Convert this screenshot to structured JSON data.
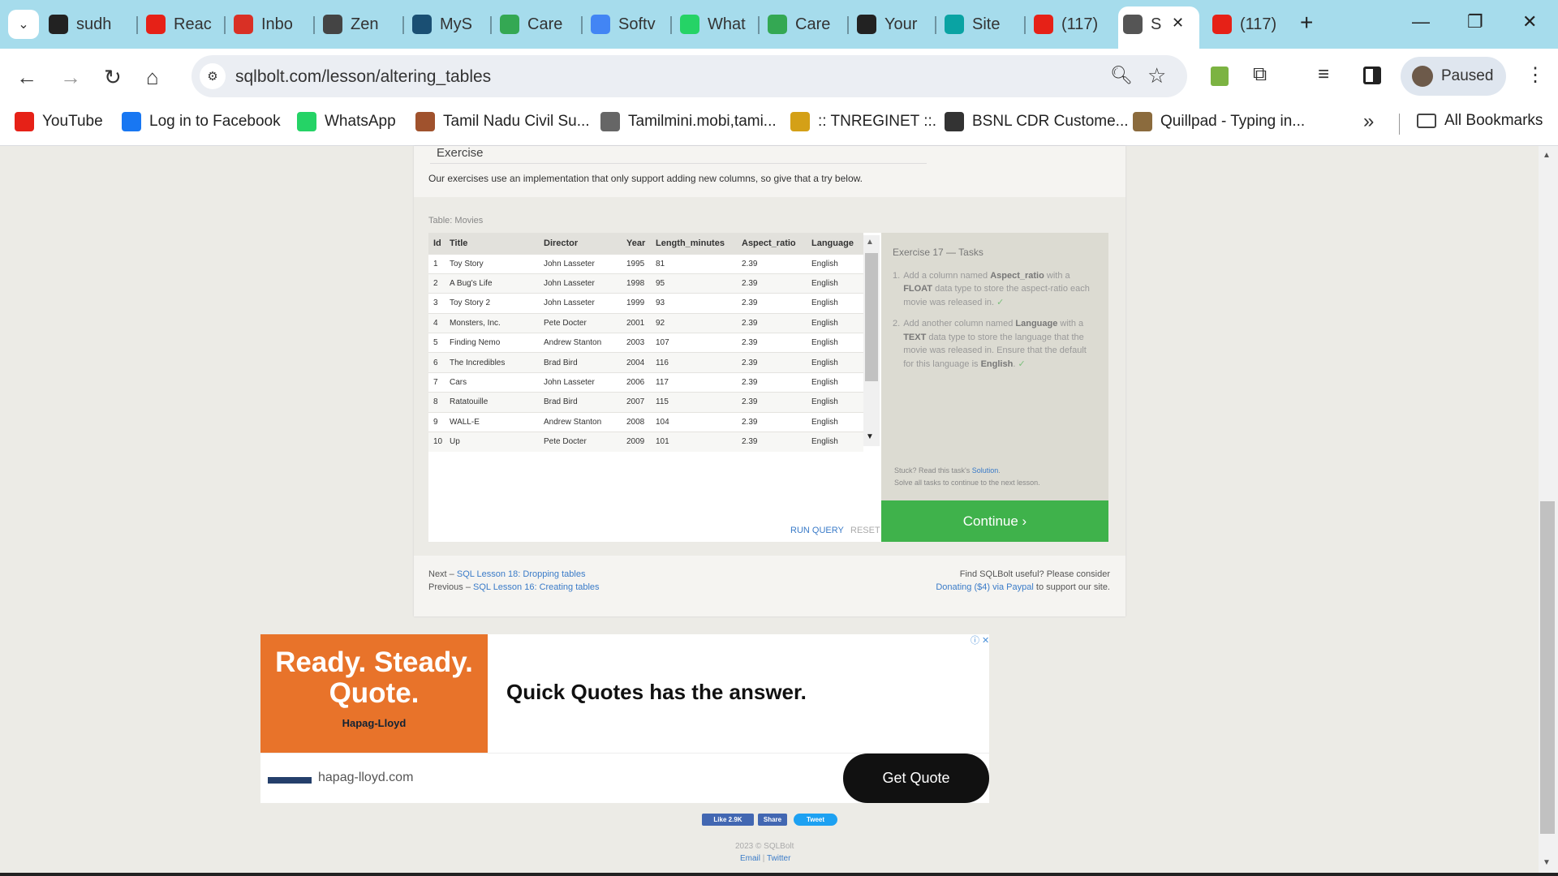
{
  "browser": {
    "tabs": [
      {
        "label": "sudh",
        "icon": "github-icon",
        "color": "#222"
      },
      {
        "label": "Reac",
        "icon": "youtube-icon",
        "color": "#e62117"
      },
      {
        "label": "Inbo",
        "icon": "gmail-icon",
        "color": "#d93025"
      },
      {
        "label": "Zen",
        "icon": "classroom-icon",
        "color": "#444"
      },
      {
        "label": "MyS",
        "icon": "mysql-icon",
        "color": "#1a4f73"
      },
      {
        "label": "Care",
        "icon": "google-circle-icon",
        "color": "#34a853"
      },
      {
        "label": "Softv",
        "icon": "docs-icon",
        "color": "#4285f4"
      },
      {
        "label": "What",
        "icon": "whatsapp-icon",
        "color": "#25d366"
      },
      {
        "label": "Care",
        "icon": "google-circle-icon",
        "color": "#34a853"
      },
      {
        "label": "Your",
        "icon": "github-icon",
        "color": "#222"
      },
      {
        "label": "Site",
        "icon": "diamond-icon",
        "color": "#0aa3a3"
      },
      {
        "label": "(117)",
        "icon": "youtube-icon",
        "color": "#e62117"
      },
      {
        "label": "S",
        "icon": "database-icon",
        "color": "#555",
        "active": true
      },
      {
        "label": "(117)",
        "icon": "youtube-icon",
        "color": "#e62117"
      }
    ],
    "url": "sqlbolt.com/lesson/altering_tables",
    "profile_label": "Paused",
    "bookmarks": [
      {
        "label": "YouTube",
        "color": "#e62117"
      },
      {
        "label": "Log in to Facebook",
        "color": "#1877f2"
      },
      {
        "label": "WhatsApp",
        "color": "#25d366"
      },
      {
        "label": "Tamil Nadu Civil Su...",
        "color": "#a0522d"
      },
      {
        "label": "Tamilmini.mobi,tami...",
        "color": "#666"
      },
      {
        "label": ":: TNREGINET ::.",
        "color": "#d4a017"
      },
      {
        "label": "BSNL CDR Custome...",
        "color": "#333"
      },
      {
        "label": "Quillpad - Typing in...",
        "color": "#8b6b3d"
      }
    ],
    "all_bookmarks": "All Bookmarks"
  },
  "lesson": {
    "exercise_heading": "Exercise",
    "exercise_desc": "Our exercises use an implementation that only support adding new columns, so give that a try below.",
    "table_label": "Table: Movies",
    "columns": [
      "Id",
      "Title",
      "Director",
      "Year",
      "Length_minutes",
      "Aspect_ratio",
      "Language"
    ],
    "rows": [
      [
        "1",
        "Toy Story",
        "John Lasseter",
        "1995",
        "81",
        "2.39",
        "English"
      ],
      [
        "2",
        "A Bug's Life",
        "John Lasseter",
        "1998",
        "95",
        "2.39",
        "English"
      ],
      [
        "3",
        "Toy Story 2",
        "John Lasseter",
        "1999",
        "93",
        "2.39",
        "English"
      ],
      [
        "4",
        "Monsters, Inc.",
        "Pete Docter",
        "2001",
        "92",
        "2.39",
        "English"
      ],
      [
        "5",
        "Finding Nemo",
        "Andrew Stanton",
        "2003",
        "107",
        "2.39",
        "English"
      ],
      [
        "6",
        "The Incredibles",
        "Brad Bird",
        "2004",
        "116",
        "2.39",
        "English"
      ],
      [
        "7",
        "Cars",
        "John Lasseter",
        "2006",
        "117",
        "2.39",
        "English"
      ],
      [
        "8",
        "Ratatouille",
        "Brad Bird",
        "2007",
        "115",
        "2.39",
        "English"
      ],
      [
        "9",
        "WALL-E",
        "Andrew Stanton",
        "2008",
        "104",
        "2.39",
        "English"
      ],
      [
        "10",
        "Up",
        "Pete Docter",
        "2009",
        "101",
        "2.39",
        "English"
      ]
    ],
    "run_query": "RUN QUERY",
    "reset": "RESET",
    "tasks_title": "Exercise 17 — Tasks",
    "task1_a": "Add a column named ",
    "task1_b": "Aspect_ratio",
    "task1_c": " with a ",
    "task1_d": "FLOAT",
    "task1_e": " data type to store the aspect-ratio each movie was released in.",
    "task2_a": "Add another column named ",
    "task2_b": "Language",
    "task2_c": " with a ",
    "task2_d": "TEXT",
    "task2_e": " data type to store the language that the movie was released in. Ensure that the default for this language is ",
    "task2_f": "English",
    "task2_g": ".",
    "check": "✓",
    "stuck_a": "Stuck? Read this task's ",
    "stuck_link": "Solution",
    "stuck_b": ".",
    "solve_all": "Solve all tasks to continue to the next lesson.",
    "continue": "Continue ›",
    "next_prefix": "Next – ",
    "next_link": "SQL Lesson 18: Dropping tables",
    "prev_prefix": "Previous – ",
    "prev_link": "SQL Lesson 16: Creating tables",
    "find_useful": "Find SQLBolt useful? Please consider",
    "donate_link": "Donating ($4) via Paypal",
    "donate_suffix": " to support our site."
  },
  "ad": {
    "headline": "Ready. Steady. Quote.",
    "brand": "Hapag-Lloyd",
    "tagline": "Quick Quotes has the answer.",
    "domain": "hapag-lloyd.com",
    "cta": "Get Quote"
  },
  "social": {
    "like": "Like 2.9K",
    "share": "Share",
    "tweet": "Tweet"
  },
  "footer": {
    "copyright": "2023 © SQLBolt",
    "email": "Email",
    "sep": " | ",
    "twitter": "Twitter"
  }
}
